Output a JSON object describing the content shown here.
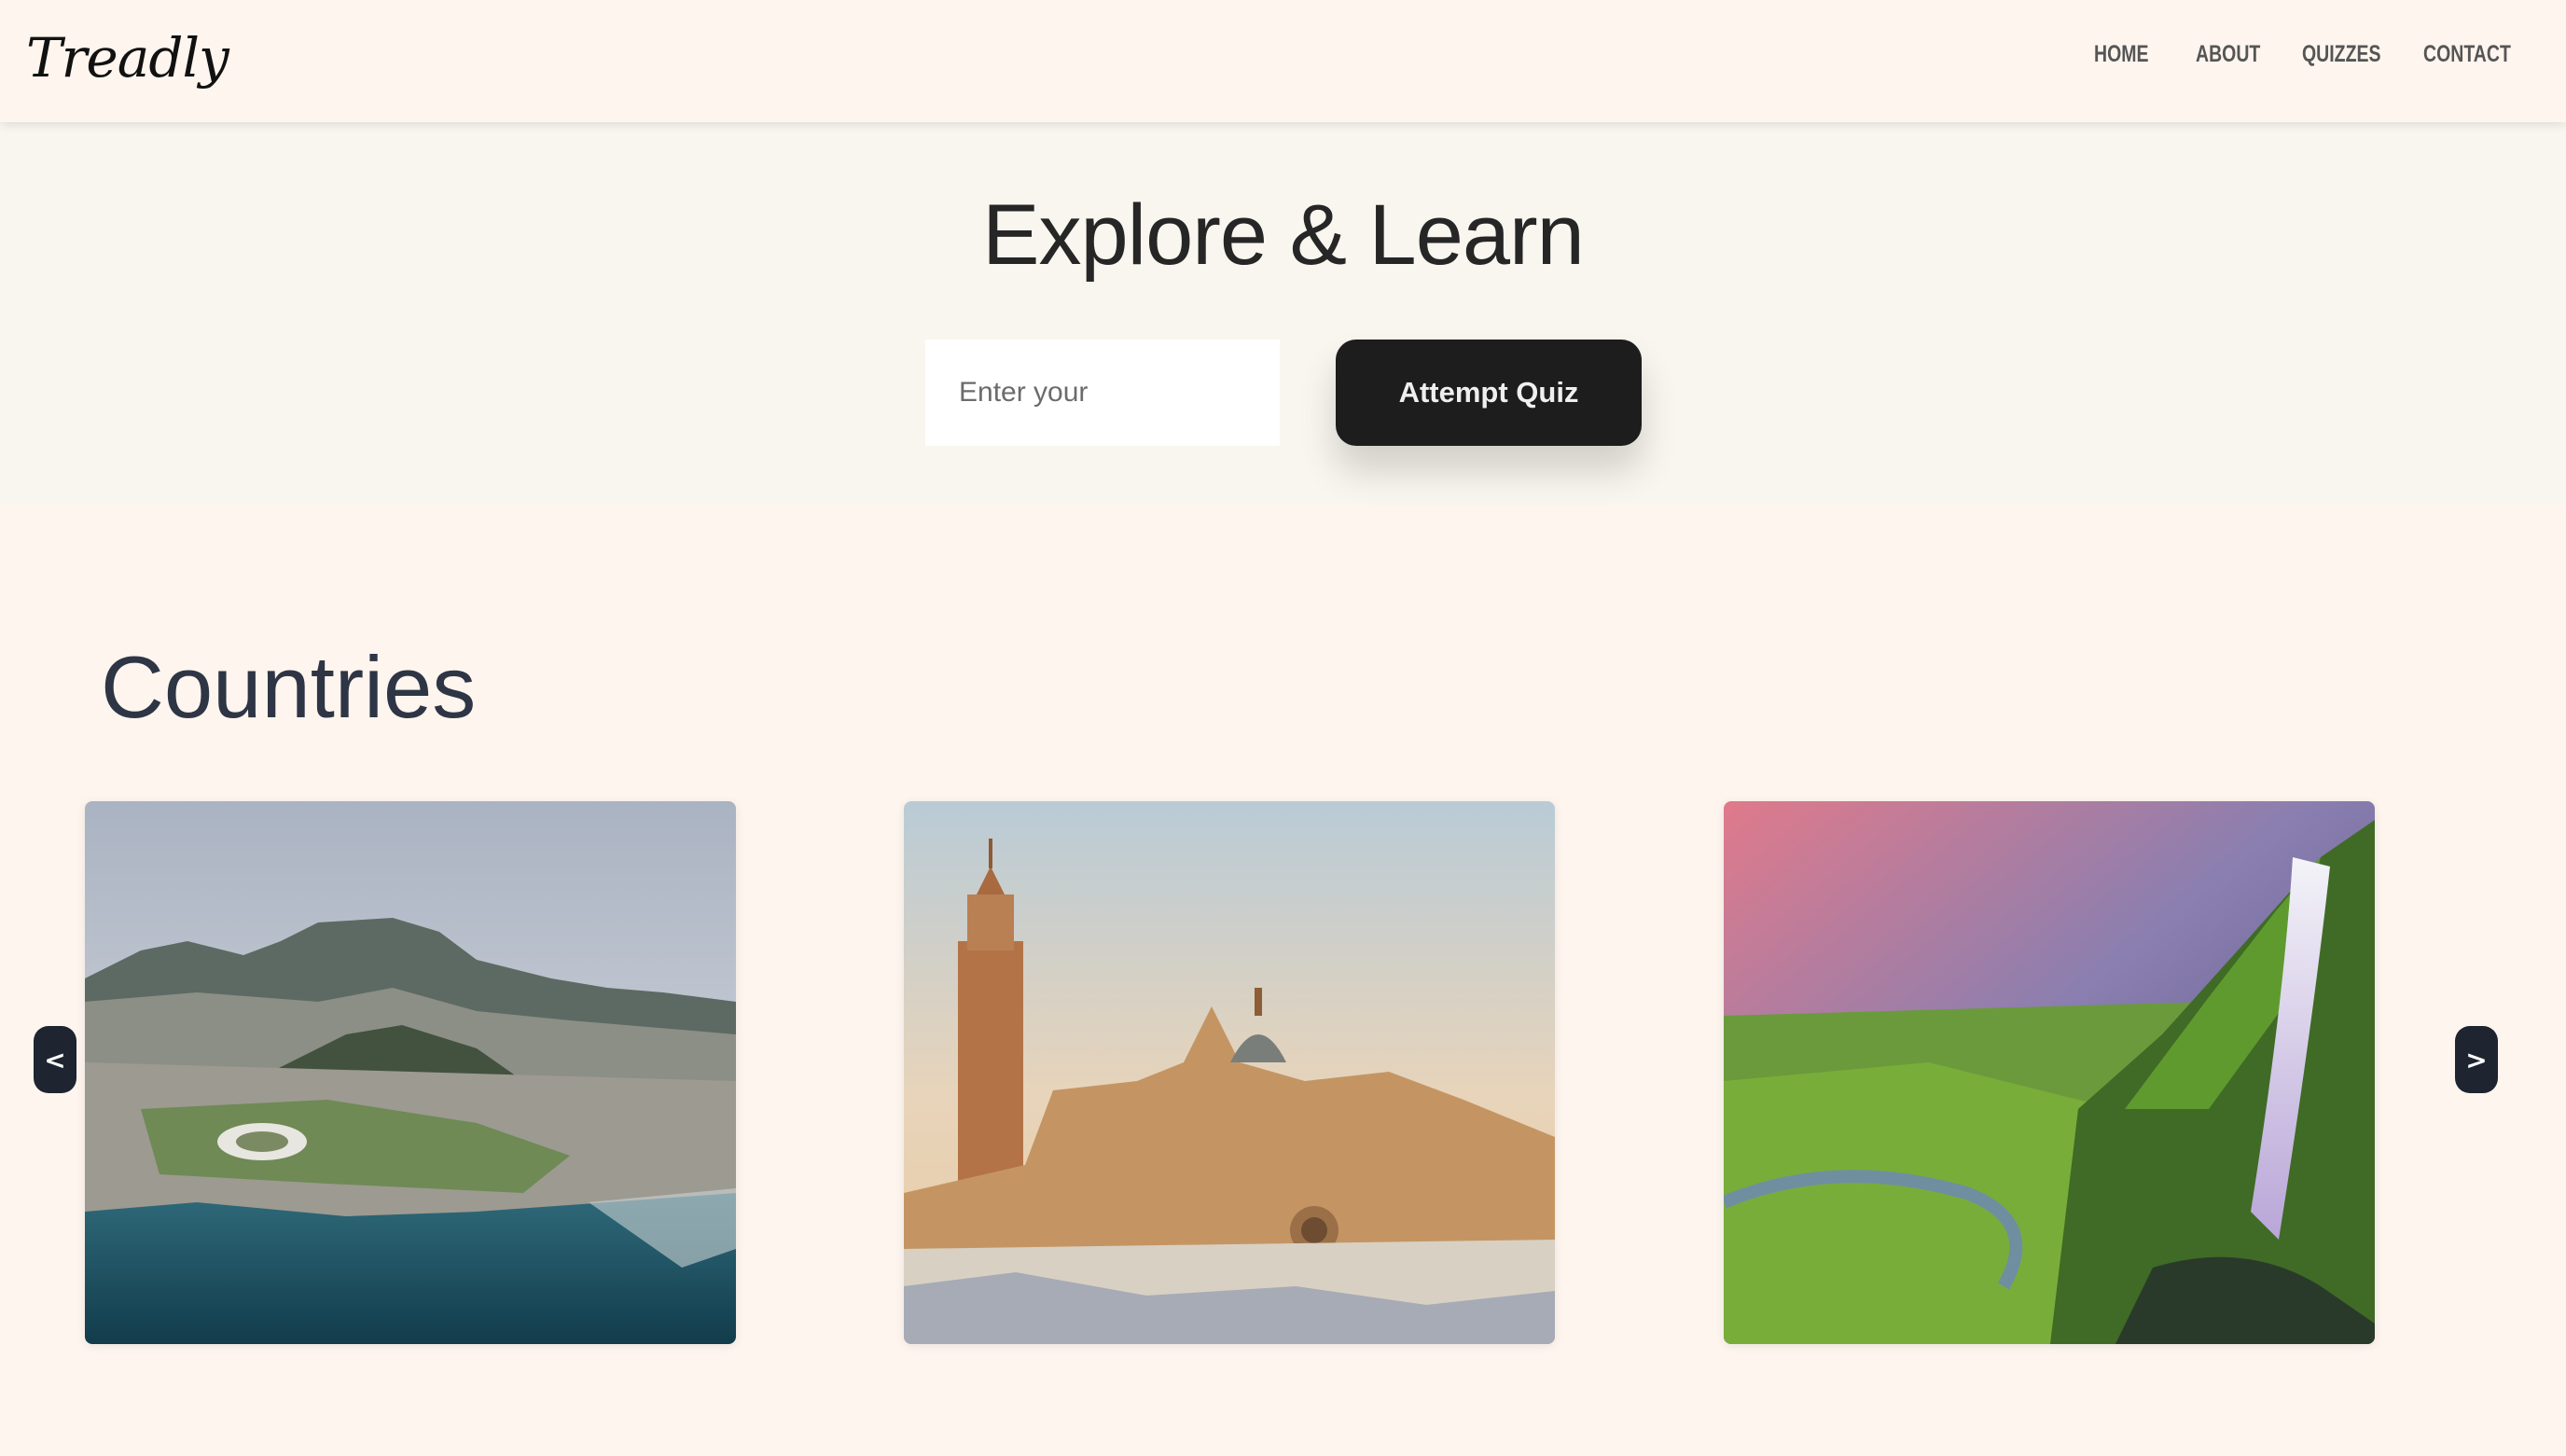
{
  "brand": {
    "logo_text": "Treadly"
  },
  "nav": {
    "items": [
      {
        "label": "HOME"
      },
      {
        "label": "ABOUT"
      },
      {
        "label": "QUIZZES"
      },
      {
        "label": "CONTACT"
      }
    ]
  },
  "hero": {
    "title": "Explore & Learn",
    "input_placeholder": "Enter your",
    "input_value": "",
    "button_label": "Attempt Quiz"
  },
  "countries": {
    "heading": "Countries",
    "prev_label": "<",
    "next_label": ">",
    "cards": [
      {
        "image": "cape-town-aerial-photo"
      },
      {
        "image": "seville-cathedral-photo"
      },
      {
        "image": "waterfall-landscape-photo"
      }
    ]
  },
  "colors": {
    "page_bg": "#fdf5ee",
    "hero_bg": "#f8f6ee",
    "button_bg": "#1d1d1d",
    "heading_text": "#2e3545",
    "arrow_bg": "#1e2430"
  }
}
